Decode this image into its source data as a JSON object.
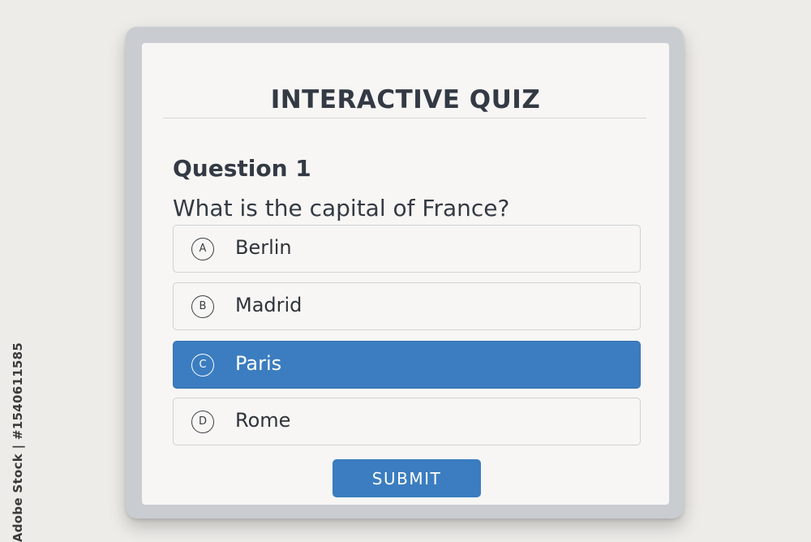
{
  "quiz": {
    "title": "INTERACTIVE QUIZ",
    "question_number": "Question 1",
    "question_text": "What is the capital of France?",
    "options": [
      {
        "badge": "A",
        "label": "Berlin",
        "selected": false
      },
      {
        "badge": "B",
        "label": "Madrid",
        "selected": false
      },
      {
        "badge": "C",
        "label": "Paris",
        "selected": true
      },
      {
        "badge": "D",
        "label": "Rome",
        "selected": false
      }
    ],
    "submit_label": "SUBMIT"
  },
  "watermark": {
    "side_text": "Adobe Stock | #1540611585"
  },
  "colors": {
    "accent": "#3b7dc0",
    "text": "#333a44",
    "panel": "#f7f6f4",
    "frame": "#c9cdd2"
  }
}
